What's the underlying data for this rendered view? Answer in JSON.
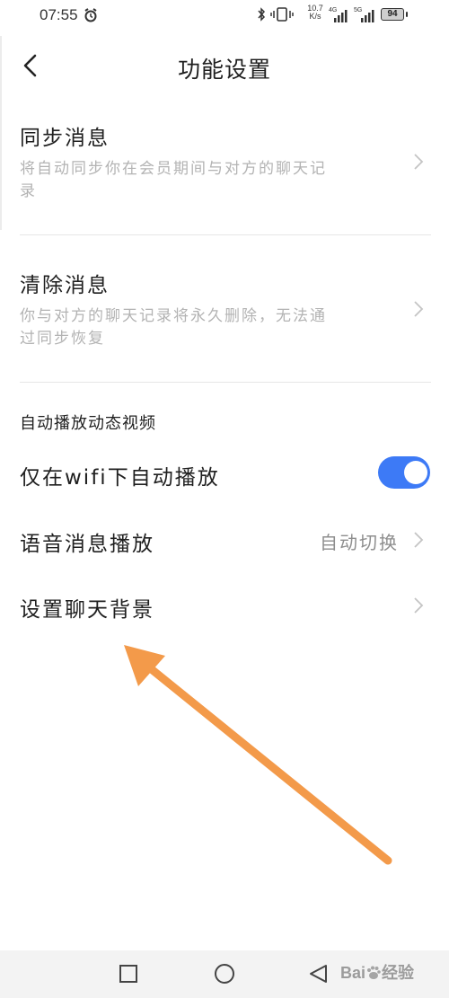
{
  "status_bar": {
    "time": "07:55",
    "speed_value": "10.7",
    "speed_unit": "K/s",
    "network_1": "4G",
    "network_2": "5G",
    "battery": "94",
    "icons": [
      "alarm-icon",
      "bluetooth-icon",
      "vibrate-icon",
      "signal-icon",
      "battery-icon"
    ]
  },
  "header": {
    "title": "功能设置",
    "back_icon": "chevron-left-icon"
  },
  "settings": {
    "sync": {
      "title": "同步消息",
      "desc_line1": "将自动同步你在会员期间与对方的聊天记",
      "desc_line2": "录"
    },
    "clear": {
      "title": "清除消息",
      "desc_line1": "你与对方的聊天记录将永久删除，无法通",
      "desc_line2": "过同步恢复"
    },
    "section_label": "自动播放动态视频",
    "wifi_autoplay": {
      "label": "仅在wifi下自动播放",
      "enabled": true
    },
    "voice_playback": {
      "label": "语音消息播放",
      "value": "自动切换"
    },
    "chat_background": {
      "label": "设置聊天背景"
    }
  },
  "nav_bar": {
    "icons": [
      "recents-square-icon",
      "home-circle-icon",
      "back-triangle-icon"
    ]
  },
  "watermark": {
    "brand": "Bai",
    "suffix": "经验"
  },
  "colors": {
    "accent": "#3d7af6",
    "annotation_arrow": "#f39a4a",
    "desc_text": "#b3b3b3"
  }
}
